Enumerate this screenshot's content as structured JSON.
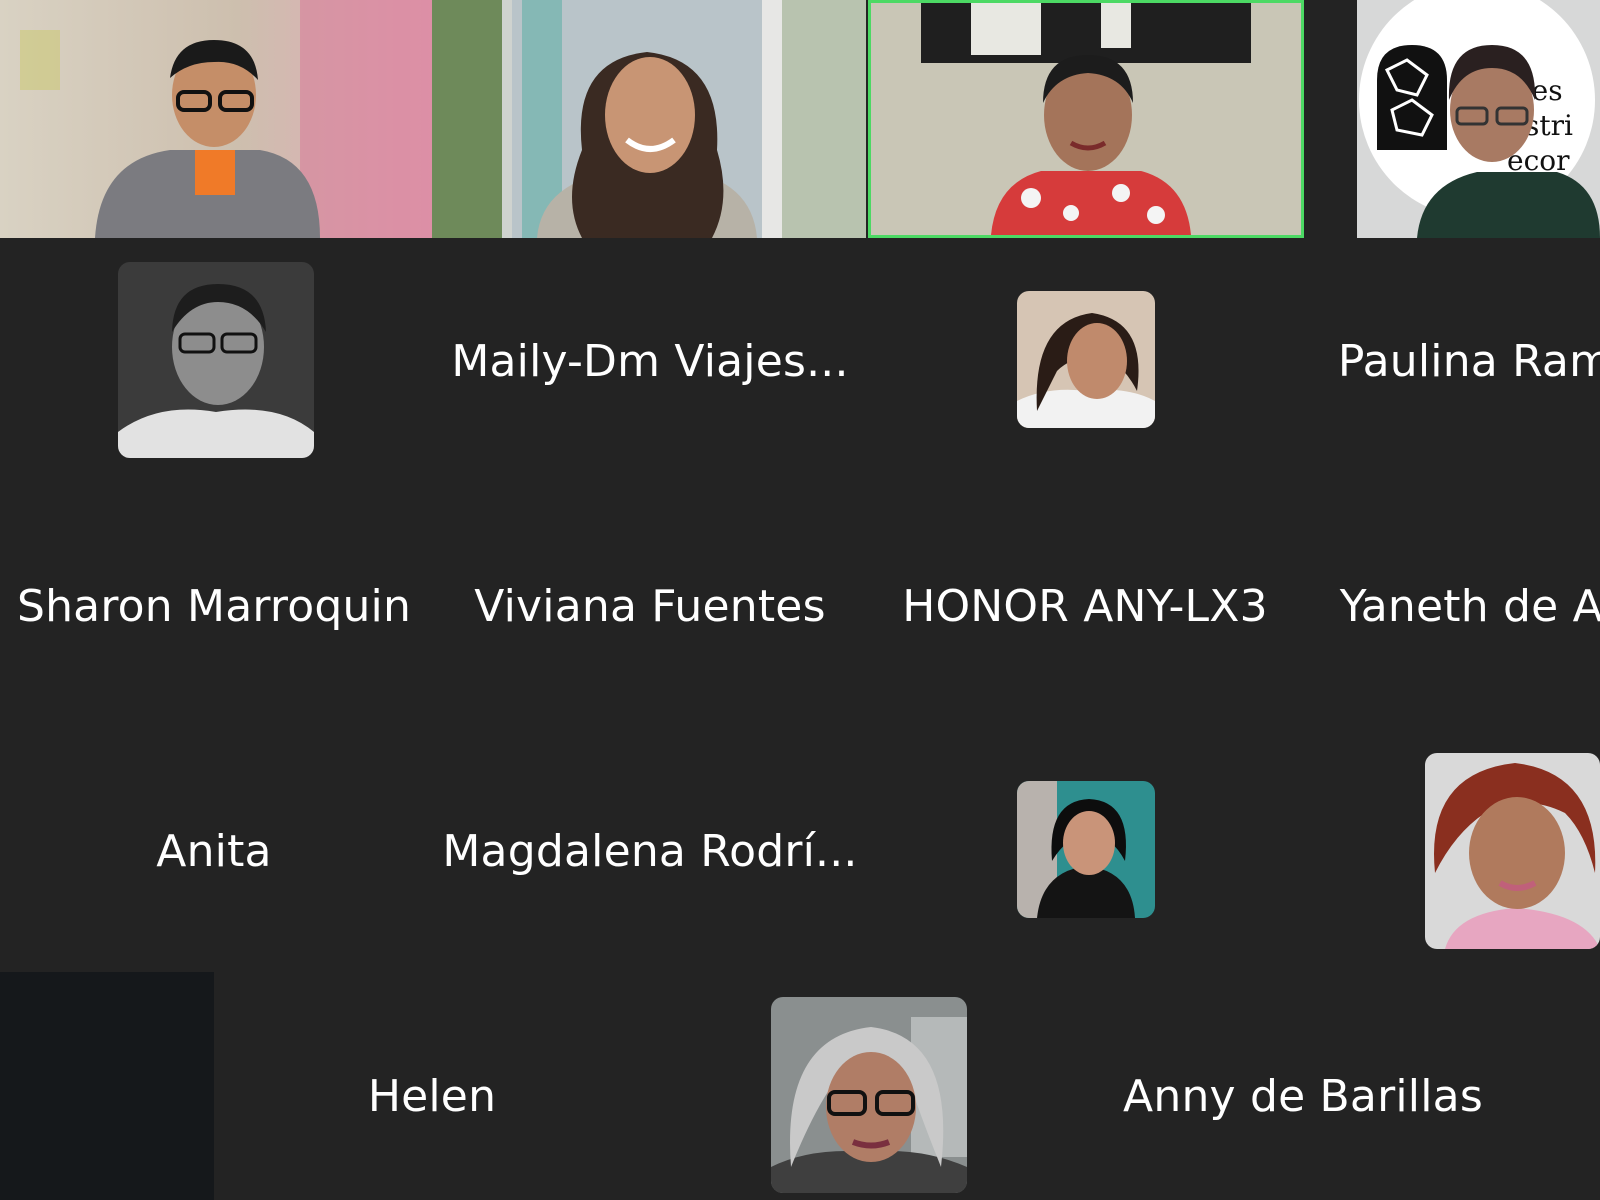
{
  "meeting": {
    "active_speaker_color": "#4cd964",
    "background_color": "#232323"
  },
  "video_tiles": [
    {
      "id": "v1",
      "icon": "participant-video",
      "active": false
    },
    {
      "id": "v2",
      "icon": "participant-video",
      "active": false
    },
    {
      "id": "v3",
      "icon": "participant-video",
      "active": true
    },
    {
      "id": "v4",
      "icon": "participant-video",
      "active": false,
      "logo_text": [
        "rtes",
        "ustri",
        "ecor"
      ]
    }
  ],
  "participants": {
    "maily": "Maily-Dm Viajes...",
    "paulina": "Paulina Ram",
    "sharon": "Sharon Marroquin",
    "viviana": "Viviana Fuentes",
    "honor": "HONOR ANY-LX3",
    "yaneth": "Yaneth de Ad",
    "anita": "Anita",
    "magdalena": "Magdalena Rodrí...",
    "helen": "Helen",
    "anny": "Anny de Barillas"
  },
  "avatars": [
    {
      "id": "a1",
      "icon": "man-glasses-avatar"
    },
    {
      "id": "a2",
      "icon": "woman-dark-hair-avatar"
    },
    {
      "id": "a3",
      "icon": "woman-selfie-avatar"
    },
    {
      "id": "a4",
      "icon": "woman-curly-red-hair-avatar"
    },
    {
      "id": "a5",
      "icon": "woman-gray-hair-glasses-avatar"
    }
  ]
}
